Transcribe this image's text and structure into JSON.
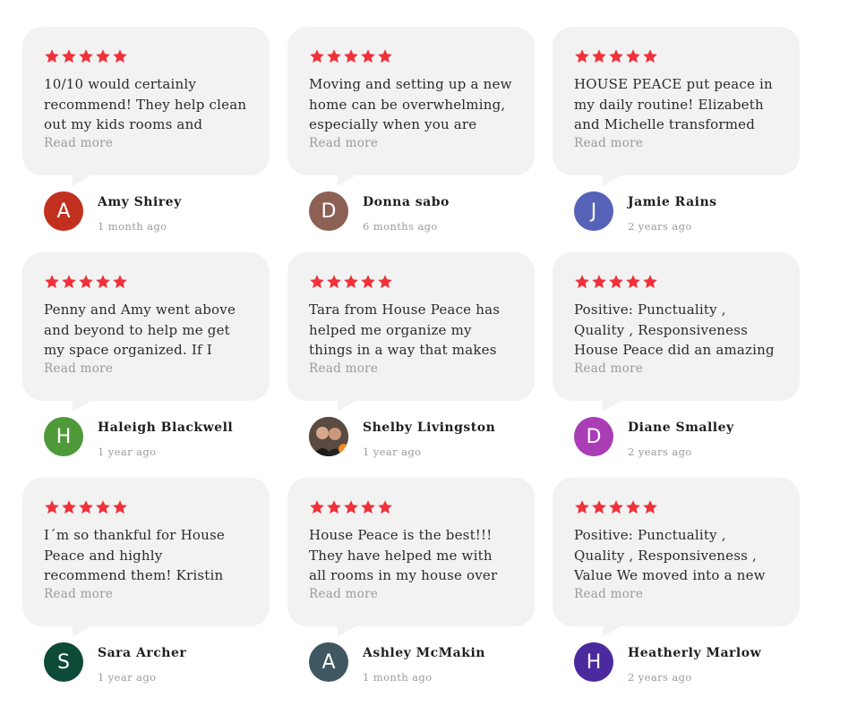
{
  "colors": {
    "star": "#f0313a",
    "bubble": "#f2f2f2",
    "muted": "#9a9a9a"
  },
  "reviews": [
    {
      "text": "10/10 would certainly recommend! They help clean out my kids rooms and closets",
      "more": "Read more",
      "initial": "A",
      "avatar_color": "#c2301f",
      "name": "Amy Shirey",
      "date": "1 month ago",
      "rating": 5
    },
    {
      "text": "Moving and setting up a new home can be overwhelming, especially when you are",
      "more": "Read more",
      "initial": "D",
      "avatar_color": "#8d6054",
      "name": "Donna sabo",
      "date": "6 months ago",
      "rating": 5
    },
    {
      "text": "HOUSE PEACE put peace in my daily routine! Elizabeth and Michelle transformed my closet",
      "more": "Read more",
      "initial": "J",
      "avatar_color": "#5562b8",
      "name": "Jamie Rains",
      "date": "2 years ago",
      "rating": 5
    },
    {
      "text": "Penny and Amy went above and beyond to help me get my space organized. If I could give",
      "more": "Read more",
      "initial": "H",
      "avatar_color": "#4f9a38",
      "name": "Haleigh Blackwell",
      "date": "1 year ago",
      "rating": 5
    },
    {
      "text": "Tara from House Peace has helped me organize my things in a way that makes sense for",
      "more": "Read more",
      "initial": "",
      "avatar_color": "#3a3a3a",
      "name": "Shelby Livingston",
      "date": "1 year ago",
      "rating": 5
    },
    {
      "text": "Positive: Punctuality , Quality , Responsiveness House Peace did an amazing job organizing",
      "more": "Read more",
      "initial": "D",
      "avatar_color": "#a93db6",
      "name": "Diane Smalley",
      "date": "2 years ago",
      "rating": 5
    },
    {
      "text": "I´m so thankful for House Peace and highly recommend them! Kristin helped me reclaim my",
      "more": "Read more",
      "initial": "S",
      "avatar_color": "#0d4a37",
      "name": "Sara Archer",
      "date": "1 year ago",
      "rating": 5
    },
    {
      "text": "House Peace is the best!!! They have helped me with all rooms in my house over the years and",
      "more": "Read more",
      "initial": "A",
      "avatar_color": "#3f5761",
      "name": "Ashley McMakin",
      "date": "1 month ago",
      "rating": 5
    },
    {
      "text": "Positive: Punctuality , Quality , Responsiveness , Value We moved into a new home and",
      "more": "Read more",
      "initial": "H",
      "avatar_color": "#4b2a9e",
      "name": "Heatherly Marlow",
      "date": "2 years ago",
      "rating": 5
    }
  ]
}
